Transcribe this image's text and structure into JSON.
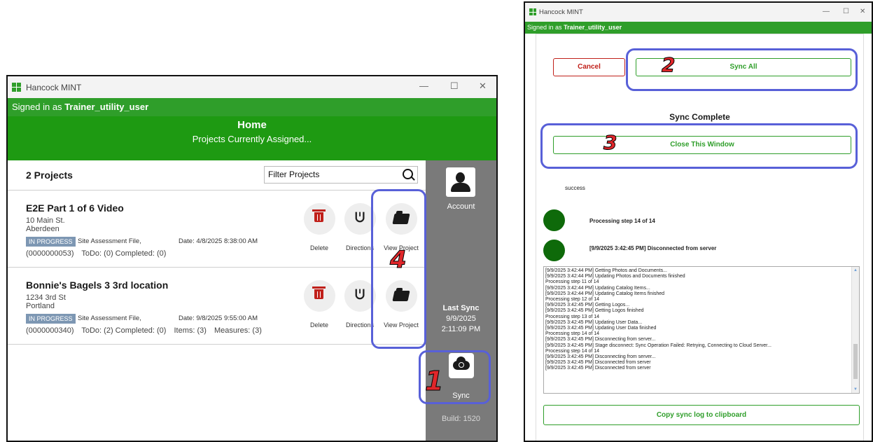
{
  "left_window": {
    "title": "Hancock MINT",
    "controls": {
      "minimize": "—",
      "maximize": "☐",
      "close": "✕"
    },
    "signed_in_prefix": "Signed in as",
    "signed_in_user": "Trainer_utility_user",
    "home_title": "Home",
    "home_subtitle": "Projects Currently Assigned...",
    "project_count": "2 Projects",
    "filter_placeholder": "Filter Projects",
    "projects": [
      {
        "name": "E2E Part 1 of 6 Video",
        "address1": "10 Main St.",
        "address2": "Aberdeen",
        "status": "IN PROGRESS",
        "file_type": "Site Assessment File,",
        "date": "Date: 4/8/2025 8:38:00 AM",
        "id": "(0000000053)",
        "todo": "ToDo: (0) Completed: (0)",
        "items": "",
        "measures": ""
      },
      {
        "name": "Bonnie's Bagels 3 3rd location",
        "address1": "1234 3rd St",
        "address2": "Portland",
        "status": "IN PROGRESS",
        "file_type": "Site Assessment File,",
        "date": "Date: 9/8/2025 9:55:00 AM",
        "id": "(0000000340)",
        "todo": "ToDo: (2) Completed: (0)",
        "items": "Items: (3)",
        "measures": "Measures: (3)"
      }
    ],
    "actions": {
      "delete": "Delete",
      "directions": "Directions",
      "view": "View Project"
    },
    "sidebar": {
      "account": "Account",
      "last_sync_label": "Last Sync",
      "last_sync_date": "9/9/2025",
      "last_sync_time": "2:11:09 PM",
      "sync": "Sync",
      "build": "Build: 1520"
    }
  },
  "right_window": {
    "title": "Hancock MINT",
    "controls": {
      "minimize": "—",
      "maximize": "☐",
      "close": "✕"
    },
    "signed_in_prefix": "Signed in as",
    "signed_in_user": "Trainer_utility_user",
    "cancel": "Cancel",
    "sync_all": "Sync All",
    "sync_complete": "Sync Complete",
    "close_window": "Close This Window",
    "success": "success",
    "step1": "Processing step 14 of 14",
    "step2": "[9/9/2025 3:42:45 PM] Disconnected from server",
    "log": [
      "[9/9/2025 3:42:44 PM] Getting Photos and Documents...",
      "[9/9/2025 3:42:44 PM] Updating Photos and Documents finished",
      "Processing step 11 of 14",
      "[9/9/2025 3:42:44 PM] Updating Catalog Items...",
      "[9/9/2025 3:42:44 PM] Updating Catalog Items finished",
      "Processing step 12 of 14",
      "[9/9/2025 3:42:45 PM] Getting Logos...",
      "[9/9/2025 3:42:45 PM] Getting Logos finished",
      "Processing step 13 of 14",
      "[9/9/2025 3:42:45 PM] Updating User Data...",
      "[9/9/2025 3:42:45 PM] Updating User Data finished",
      "Processing step 14 of 14",
      "[9/9/2025 3:42:45 PM] Disconnecting from server...",
      "[9/9/2025 3:42:45 PM] Stage disconnect: Sync Operation Failed: Retrying, Connecting to Cloud Server...",
      "Processing step 14 of 14",
      "[9/9/2025 3:42:45 PM] Disconnecting from server...",
      "[9/9/2025 3:42:45 PM] Disconnected from server",
      "[9/9/2025 3:42:45 PM] Disconnected from server"
    ],
    "copy_log": "Copy sync log to clipboard"
  },
  "annotations": {
    "n1": "1",
    "n2": "2",
    "n3": "3",
    "n4": "4",
    "color": "#5860d8",
    "number_color": "#e0262a"
  },
  "colors": {
    "green": "#2f9e2a",
    "home_green": "#1e9a12",
    "sidebar_gray": "#7a7a7a",
    "status_blue": "#7d97b3",
    "delete_red": "#c0201a"
  }
}
